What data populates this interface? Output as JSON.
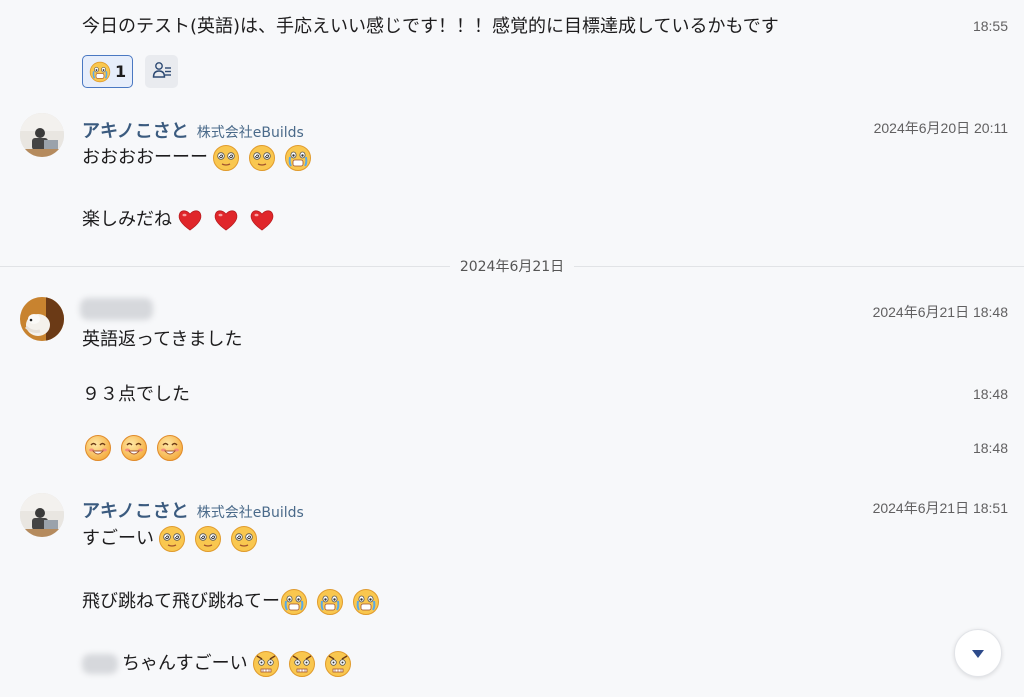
{
  "messages": {
    "m0": {
      "text": "今日のテスト(英語)は、手応えいい感じです！！！感覚的に目標達成しているかもです",
      "time": "18:55"
    },
    "reaction": {
      "count": "1",
      "emoji": "teary-face-emoji"
    },
    "g1": {
      "sender": "アキノこさと",
      "org": "株式会社eBuilds",
      "time": "2024年6月20日 20:11",
      "line1": "おおおおーーー",
      "line2": "楽しみだね"
    },
    "date_divider": "2024年6月21日",
    "g2": {
      "time": "2024年6月21日 18:48",
      "line1": "英語返ってきました",
      "line2": "９３点でした",
      "line2_time": "18:48",
      "line3_time": "18:48"
    },
    "g3": {
      "sender": "アキノこさと",
      "org": "株式会社eBuilds",
      "time": "2024年6月21日 18:51",
      "line1": "すごーい",
      "line2": "飛び跳ねて飛び跳ねてー",
      "line3_suffix": "ちゃんすごーい"
    }
  },
  "icons": {
    "reaction_emoji": "crying-face-emoji",
    "add_reaction": "person-list-icon",
    "scroll_down": "triangle-down-icon"
  },
  "colors": {
    "background": "#f7f8fa",
    "sender_name": "#3b5b7f",
    "reaction_border": "#4a78c2",
    "heart": "#e0262a"
  }
}
